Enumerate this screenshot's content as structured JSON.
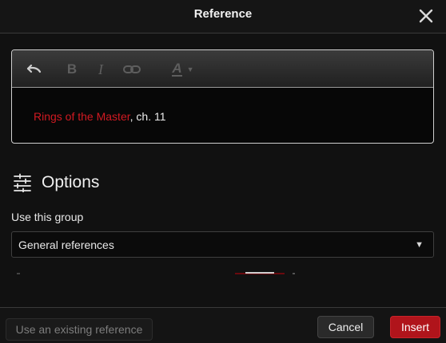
{
  "dialog": {
    "title": "Reference",
    "close_icon": "close-icon"
  },
  "editor": {
    "toolbar": {
      "undo_icon": "undo-icon",
      "bold_label": "B",
      "italic_label": "I",
      "link_icon": "link-icon",
      "text_color_label": "A",
      "text_color_caret": "▼"
    },
    "content": {
      "ref_title": "Rings of the Master",
      "ref_suffix": ", ch. 11"
    }
  },
  "options": {
    "icon": "sliders-icon",
    "title": "Options",
    "group_label": "Use this group",
    "group_select": {
      "value": "General references",
      "arrow": "▼"
    }
  },
  "footer": {
    "use_existing_label": "Use an existing reference",
    "cancel_label": "Cancel",
    "insert_label": "Insert"
  },
  "colors": {
    "accent": "#b0141b",
    "reference_link": "#d21a22",
    "background": "#111111"
  }
}
